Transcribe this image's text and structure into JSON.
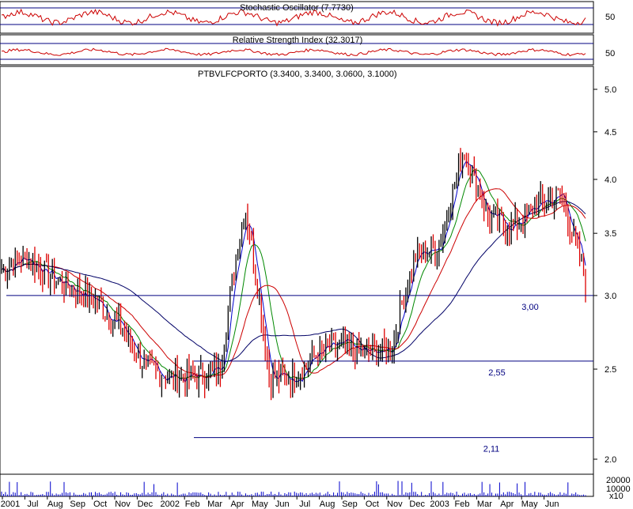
{
  "chart_data": {
    "type": "candlestick",
    "panels": {
      "stochastic": {
        "title": "Stochastic Oscillator (7.7730)",
        "tick_labels": [
          "50"
        ],
        "series_color": "#cc0000"
      },
      "rsi": {
        "title": "Relative Strength Index (32.3017)",
        "tick_labels": [
          "50"
        ],
        "series_color": "#cc0000"
      },
      "price": {
        "title": "PTBVLFCPORTO (3.3400, 3.3400, 3.0600, 3.1000)",
        "y_scale": "log",
        "ylim": [
          1.9,
          5.3
        ],
        "y_tick_labels": [
          "5.0",
          "4.5",
          "4.0",
          "3.5",
          "3.0",
          "2.5",
          "2.0"
        ],
        "y_ticks": [
          5.0,
          4.5,
          4.0,
          3.5,
          3.0,
          2.5,
          2.0
        ],
        "x_tick_labels": [
          "2001",
          "Jul",
          "Aug",
          "Sep",
          "Oct",
          "Nov",
          "Dec",
          "2002",
          "Feb",
          "Mar",
          "Apr",
          "May",
          "Jun",
          "Jul",
          "Aug",
          "Sep",
          "Oct",
          "Nov",
          "Dec",
          "2003",
          "Feb",
          "Mar",
          "Apr",
          "May",
          "Jun"
        ],
        "support_lines": [
          {
            "label": "3,00",
            "value": 3.0
          },
          {
            "label": "2,55",
            "value": 2.55
          },
          {
            "label": "2,11",
            "value": 2.11
          }
        ],
        "monthly_close": [
          [
            "2001-06",
            3.2
          ],
          [
            "2001-07",
            3.3
          ],
          [
            "2001-08",
            3.15
          ],
          [
            "2001-09",
            3.05
          ],
          [
            "2001-10",
            2.95
          ],
          [
            "2001-11",
            2.75
          ],
          [
            "2001-12",
            2.5
          ],
          [
            "2002-01",
            2.45
          ],
          [
            "2002-02",
            2.45
          ],
          [
            "2002-03",
            2.5
          ],
          [
            "2002-04",
            3.75
          ],
          [
            "2002-05",
            2.45
          ],
          [
            "2002-06",
            2.45
          ],
          [
            "2002-07",
            2.6
          ],
          [
            "2002-08",
            2.65
          ],
          [
            "2002-09",
            2.6
          ],
          [
            "2002-10",
            2.62
          ],
          [
            "2002-11",
            3.3
          ],
          [
            "2002-12",
            3.4
          ],
          [
            "2003-01",
            4.3
          ],
          [
            "2003-02",
            3.65
          ],
          [
            "2003-03",
            3.55
          ],
          [
            "2003-04",
            3.75
          ],
          [
            "2003-05",
            3.85
          ],
          [
            "2003-06",
            3.1
          ]
        ],
        "moving_average_colors": [
          "#0000cc",
          "#008800",
          "#cc0000",
          "#000066"
        ]
      },
      "volume": {
        "tick_labels": [
          "20000",
          "10000",
          "x10"
        ],
        "series_color": "#0000cc"
      }
    },
    "colors": {
      "up_bar": "#000000",
      "down_bar": "#dd0000",
      "support_line": "#000080",
      "label": "#000080",
      "border": "#000000"
    }
  }
}
